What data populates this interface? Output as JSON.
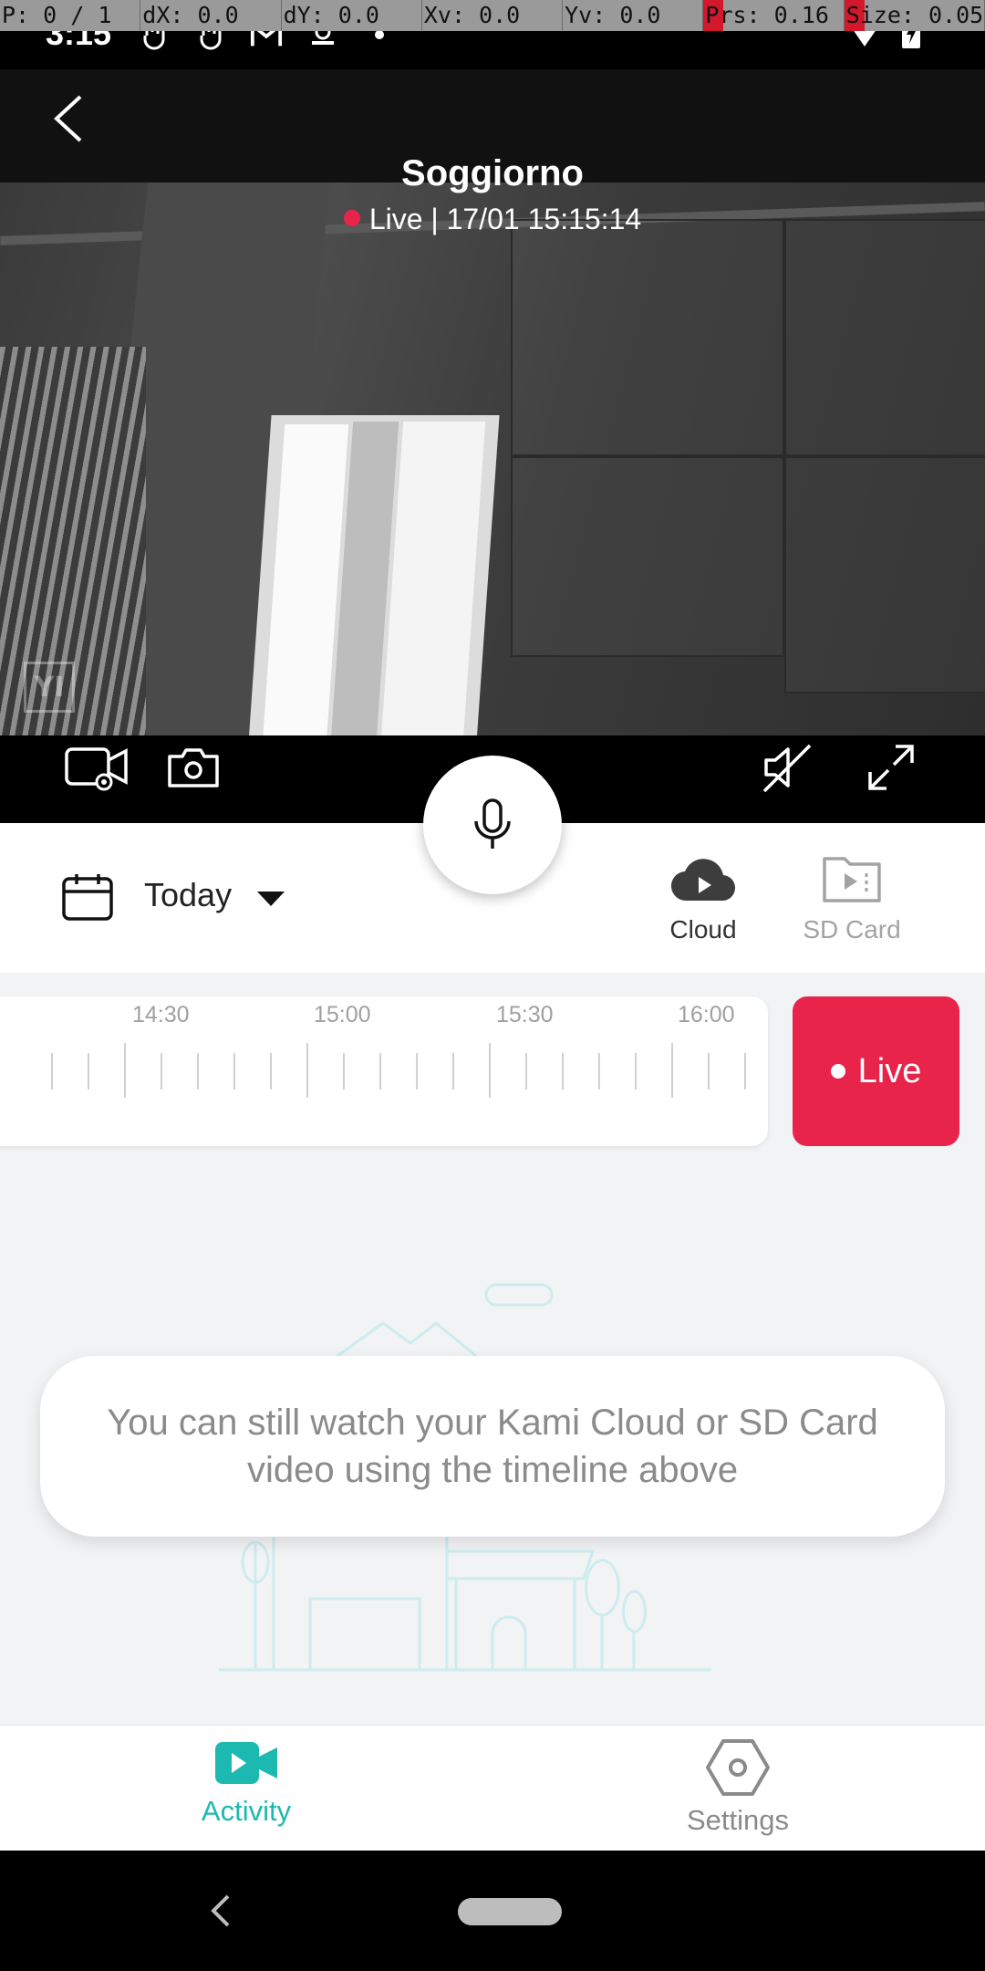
{
  "debug": [
    "P: 0 / 1",
    "dX: 0.0",
    "dY: 0.0",
    "Xv: 0.0",
    "Yv: 0.0",
    "Prs: 0.16",
    "Size: 0.05"
  ],
  "status_bar": {
    "time": "3:15",
    "notification_icons": [
      "hand-icon",
      "hand-icon",
      "gmail-icon",
      "app-icon",
      "dot-icon"
    ],
    "right_icons": [
      "wifi-icon",
      "battery-charging-icon"
    ]
  },
  "header": {
    "title": "Soggiorno",
    "live_status": "Live | 17/01 15:15:14",
    "live_dot_color": "#e8244b"
  },
  "controls": {
    "left": [
      "record-video-icon",
      "snapshot-icon"
    ],
    "center": "microphone-icon",
    "right": [
      "mute-icon",
      "fullscreen-icon"
    ]
  },
  "date_filter": {
    "label": "Today",
    "icon": "calendar-icon"
  },
  "sources": [
    {
      "label": "Cloud",
      "icon": "cloud-play-icon",
      "active": true
    },
    {
      "label": "SD Card",
      "icon": "sd-folder-icon",
      "active": false
    }
  ],
  "timeline": {
    "ticks": [
      "14:30",
      "15:00",
      "15:30",
      "16:00"
    ]
  },
  "live_button": {
    "label": "Live",
    "color": "#e8244b"
  },
  "empty_state": {
    "message": "You can still watch your Kami Cloud or SD Card video using the timeline above"
  },
  "bottom_nav": [
    {
      "label": "Activity",
      "icon": "video-camera-icon",
      "active": true,
      "color": "#1cb9b0"
    },
    {
      "label": "Settings",
      "icon": "hexagon-settings-icon",
      "active": false
    }
  ],
  "system_nav": [
    "back-icon",
    "home-pill"
  ]
}
